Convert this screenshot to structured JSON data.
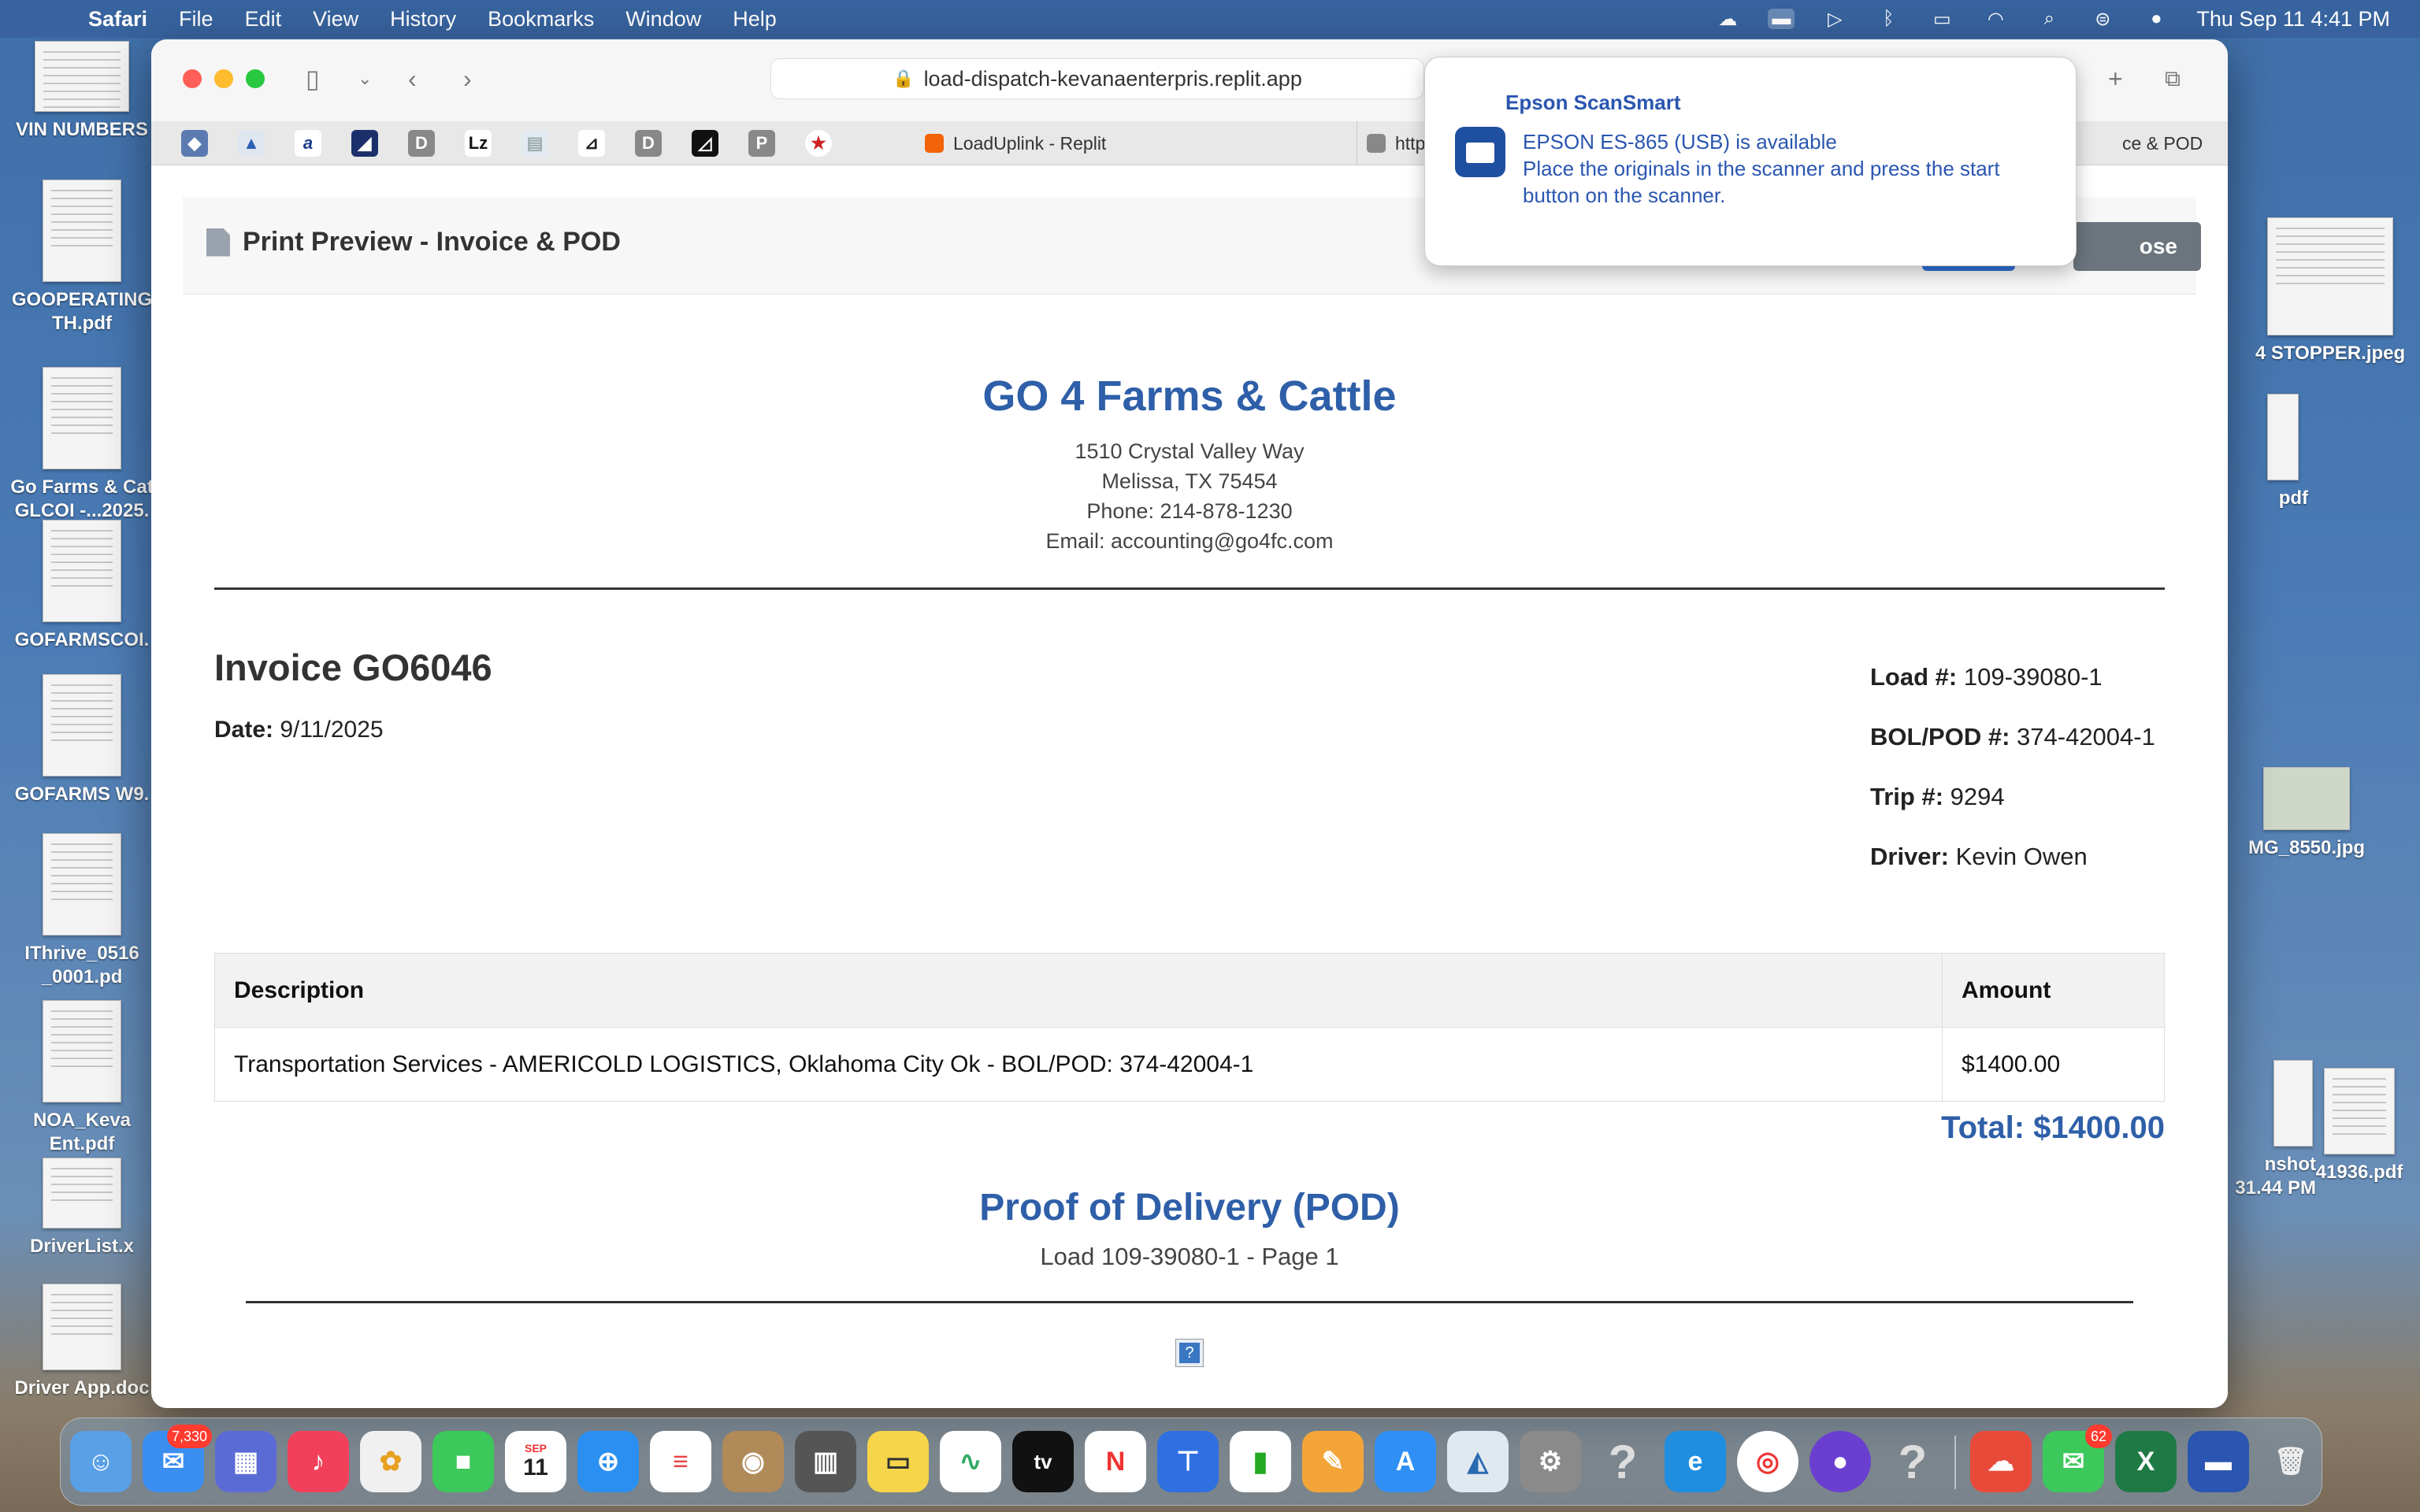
{
  "menubar": {
    "app": "Safari",
    "menus": [
      "File",
      "Edit",
      "View",
      "History",
      "Bookmarks",
      "Window",
      "Help"
    ],
    "clock": "Thu Sep 11  4:41 PM"
  },
  "desktop_files": [
    {
      "label": "VIN NUMBERS"
    },
    {
      "label": "GOOPERATING TH.pdf"
    },
    {
      "label": "Go Farms & Cat GLCOI -...2025."
    },
    {
      "label": "GOFARMSCOI."
    },
    {
      "label": "GOFARMS W9."
    },
    {
      "label": "IThrive_0516 _0001.pd"
    },
    {
      "label": "NOA_Keva Ent.pdf"
    },
    {
      "label": "DriverList.x"
    },
    {
      "label": "Driver App.doc"
    },
    {
      "label": "4 STOPPER.jpeg"
    },
    {
      "label": "pdf"
    },
    {
      "label": "MG_8550.jpg"
    },
    {
      "label": "nshot 31.44 PM"
    },
    {
      "label": "41936.pdf"
    }
  ],
  "browser": {
    "url": "load-dispatch-kevanaenterpris.replit.app",
    "tabs": [
      {
        "label": "LoadUplink - Replit"
      },
      {
        "label": "https://load-dispatch-"
      },
      {
        "label": "ce & POD"
      }
    ],
    "favorites": [
      "D",
      "Lz",
      "D",
      "P"
    ]
  },
  "print_preview": {
    "title": "Print Preview - Invoice & POD",
    "close_label": "ose"
  },
  "invoice": {
    "company_name": "GO 4 Farms & Cattle",
    "address_line1": "1510 Crystal Valley Way",
    "address_line2": "Melissa, TX 75454",
    "phone": "Phone: 214-878-1230",
    "email": "Email: accounting@go4fc.com",
    "title": "Invoice GO6046",
    "date_label": "Date:",
    "date": "9/11/2025",
    "load_label": "Load #:",
    "load": "109-39080-1",
    "bol_label": "BOL/POD #:",
    "bol": "374-42004-1",
    "trip_label": "Trip #:",
    "trip": "9294",
    "driver_label": "Driver:",
    "driver": "Kevin Owen",
    "table": {
      "headers": [
        "Description",
        "Amount"
      ],
      "rows": [
        {
          "description": "Transportation Services - AMERICOLD LOGISTICS, Oklahoma City Ok - BOL/POD: 374-42004-1",
          "amount": "$1400.00"
        }
      ]
    },
    "total": "Total: $1400.00"
  },
  "pod": {
    "title": "Proof of Delivery (POD)",
    "subtitle": "Load 109-39080-1 - Page 1",
    "image_placeholder": "?"
  },
  "notification": {
    "app": "Epson ScanSmart",
    "line1": "EPSON ES-865 (USB) is available",
    "line2": "Place the originals in the scanner and press the start",
    "line3": "button on the scanner."
  },
  "dock": {
    "mail_badge": "7,330",
    "calendar_month": "SEP",
    "calendar_day": "11",
    "messages_badge": "62"
  },
  "colors": {
    "accent_blue": "#2e5fa8",
    "notification_blue": "#2a56b0",
    "close_button": "#6c757d"
  }
}
